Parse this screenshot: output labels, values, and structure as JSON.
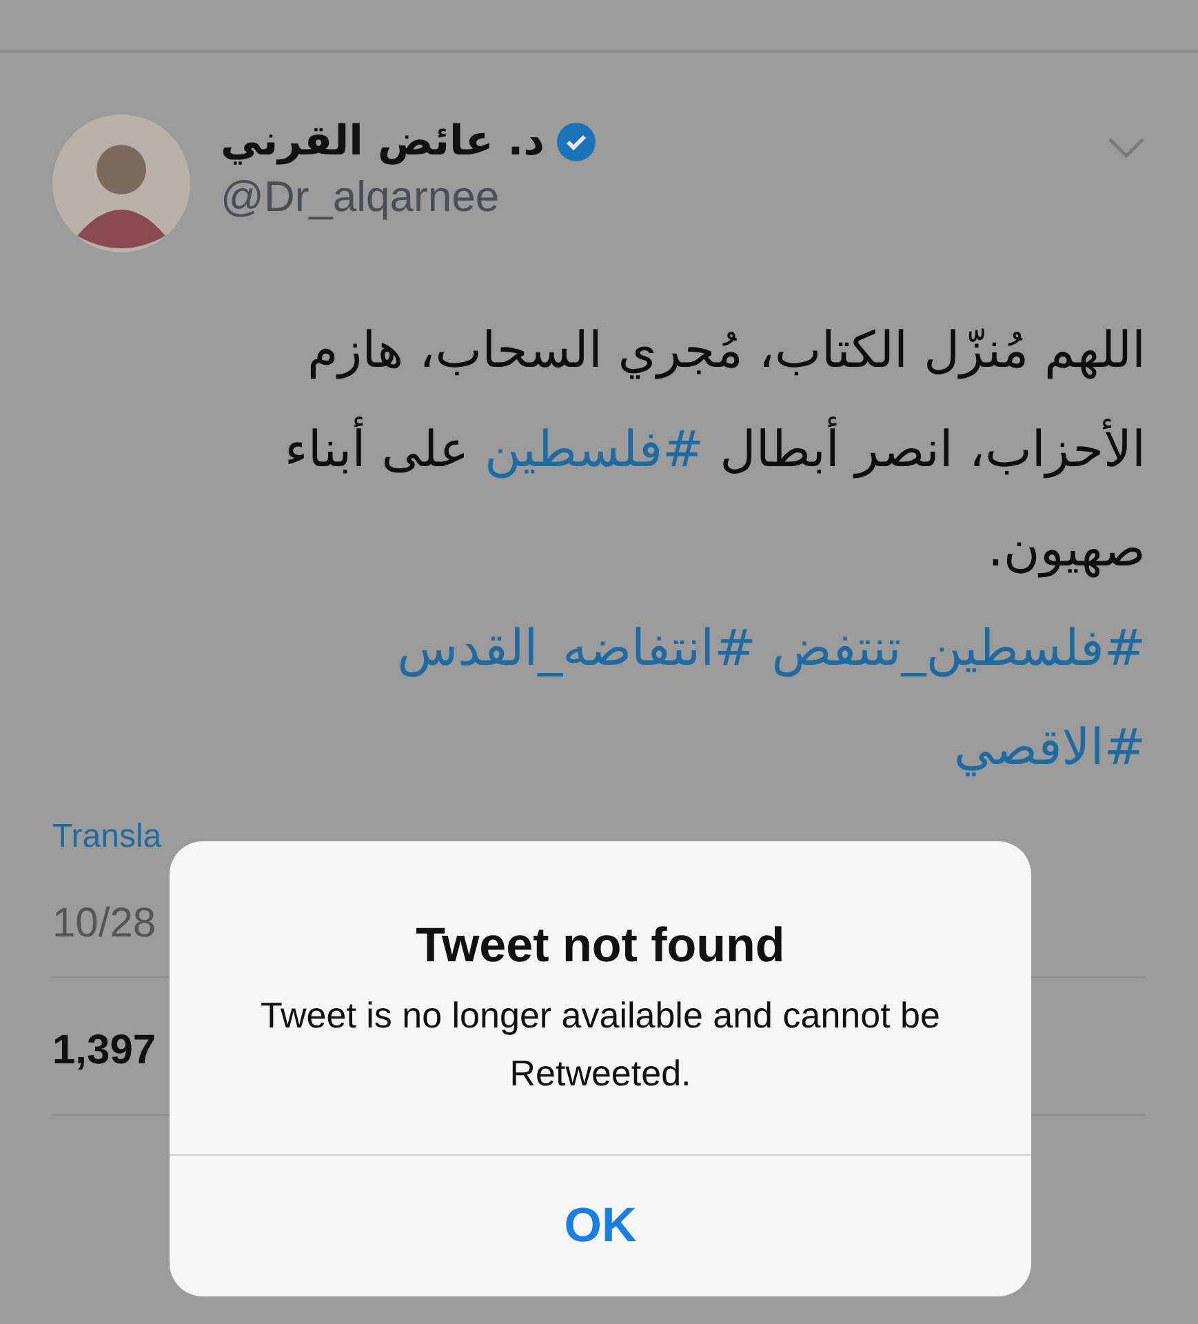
{
  "tweet": {
    "author": {
      "name": "د. عائض القرني",
      "verified": true,
      "handle": "@Dr_alqarnee"
    },
    "body": [
      {
        "kind": "text",
        "text": "اللهم مُنزّل الكتاب، مُجري السحاب، هازم الأحزاب، انصر أبطال "
      },
      {
        "kind": "hashtag",
        "text": "#فلسطين"
      },
      {
        "kind": "text",
        "text": " على أبناء صهيون."
      }
    ],
    "hashtags": [
      "#فلسطين_تنتفض",
      "#انتفاضه_القدس",
      "#الاقصي"
    ],
    "translate": "Transla",
    "date": "10/28",
    "count": "1,397"
  },
  "alert": {
    "title": "Tweet not found",
    "message": "Tweet is no longer available and cannot be Retweeted.",
    "button": "OK"
  }
}
